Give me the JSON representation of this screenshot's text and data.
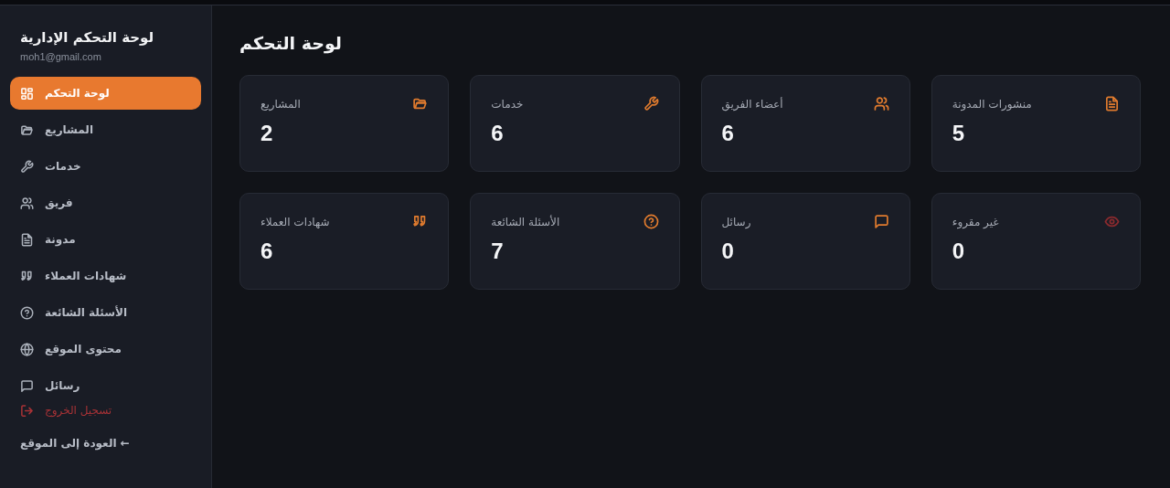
{
  "sidebar": {
    "title": "لوحة التحكم الإدارية",
    "email": "moh1@gmail.com",
    "items": [
      {
        "label": "لوحة التحكم",
        "kind": "grid",
        "selected": true
      },
      {
        "label": "المشاريع",
        "kind": "folder",
        "selected": false
      },
      {
        "label": "خدمات",
        "kind": "wrench",
        "selected": false
      },
      {
        "label": "فريق",
        "kind": "users",
        "selected": false
      },
      {
        "label": "مدونة",
        "kind": "file",
        "selected": false
      },
      {
        "label": "شهادات العملاء",
        "kind": "quote",
        "selected": false
      },
      {
        "label": "الأسئلة الشائعة",
        "kind": "help",
        "selected": false
      },
      {
        "label": "محتوى الموقع",
        "kind": "globe",
        "selected": false
      },
      {
        "label": "رسائل",
        "kind": "message",
        "selected": false
      }
    ],
    "logout": {
      "label": "تسجيل الخروج",
      "kind": "logout"
    },
    "back_link": "← العودة إلى الموقع"
  },
  "main": {
    "title": "لوحة التحكم",
    "cards": [
      {
        "label": "منشورات المدونة",
        "value": "5",
        "kind": "file",
        "color": "#e07b2e"
      },
      {
        "label": "أعضاء الفريق",
        "value": "6",
        "kind": "users",
        "color": "#e07b2e"
      },
      {
        "label": "خدمات",
        "value": "6",
        "kind": "wrench",
        "color": "#e07b2e"
      },
      {
        "label": "المشاريع",
        "value": "2",
        "kind": "folder",
        "color": "#e07b2e"
      },
      {
        "label": "غير مقروء",
        "value": "0",
        "kind": "eye",
        "color": "#8a2a2e"
      },
      {
        "label": "رسائل",
        "value": "0",
        "kind": "message",
        "color": "#e07b2e"
      },
      {
        "label": "الأسئلة الشائعة",
        "value": "7",
        "kind": "help",
        "color": "#e07b2e"
      },
      {
        "label": "شهادات العملاء",
        "value": "6",
        "kind": "quote",
        "color": "#e07b2e"
      }
    ]
  }
}
